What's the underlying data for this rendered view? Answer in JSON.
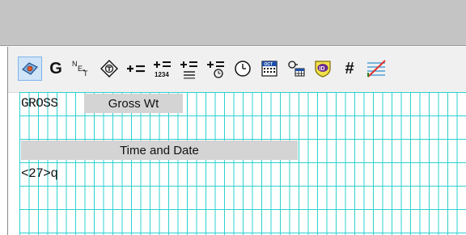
{
  "toolbar": {
    "tools": [
      {
        "name": "select-tool-icon"
      },
      {
        "name": "gross-weight-tool-icon",
        "text": "G"
      },
      {
        "name": "net-tare-tool-icon"
      },
      {
        "name": "diamond-t-tool-icon"
      },
      {
        "name": "add-field-tool-icon"
      },
      {
        "name": "add-numeric-field-tool-icon"
      },
      {
        "name": "add-text-field-tool-icon"
      },
      {
        "name": "add-time-field-tool-icon"
      },
      {
        "name": "clock-tool-icon"
      },
      {
        "name": "date-calendar-tool-icon"
      },
      {
        "name": "key-grid-tool-icon"
      },
      {
        "name": "id-shield-tool-icon"
      },
      {
        "name": "hash-tool-icon",
        "text": "#"
      },
      {
        "name": "line-draw-tool-icon"
      }
    ]
  },
  "grid": {
    "gross_code": "GROSS",
    "gross_label": "Gross Wt",
    "time_date_label": "Time and Date",
    "code_27": "<27>q"
  },
  "colors": {
    "grid_line": "#2fd0d0",
    "field_fill": "#d4d4d4",
    "toolbar_bg": "#f0f0f0",
    "titlebar_bg": "#c4c4c4"
  }
}
